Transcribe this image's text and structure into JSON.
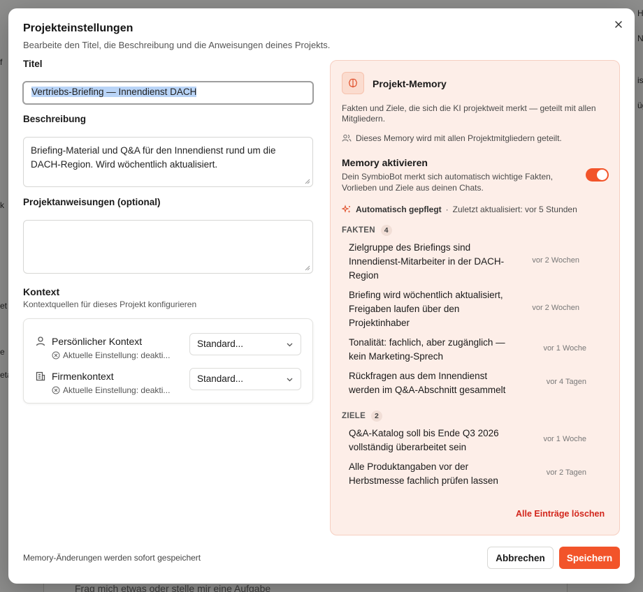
{
  "background": {
    "left_fragments": [
      "f",
      "k",
      "et",
      "e",
      "eta"
    ],
    "right_fragments": [
      "HA",
      "No",
      "is",
      "üg"
    ],
    "composer_placeholder": "Frag mich etwas oder stelle mir eine Aufgabe"
  },
  "dialog": {
    "title": "Projekteinstellungen",
    "subtitle": "Bearbeite den Titel, die Beschreibung und die Anweisungen deines Projekts.",
    "close_icon": "close-icon"
  },
  "form": {
    "title_label": "Titel",
    "title_value": "Vertriebs-Briefing — Innendienst DACH",
    "description_label": "Beschreibung",
    "description_value": "Briefing-Material und Q&A für den Innendienst rund um die DACH-Region. Wird wöchentlich aktualisiert.",
    "instructions_label": "Projektanweisungen (optional)",
    "instructions_value": ""
  },
  "context": {
    "title": "Kontext",
    "subtitle": "Kontextquellen für dieses Projekt konfigurieren",
    "rows": [
      {
        "name": "Persönlicher Kontext",
        "icon": "person-icon",
        "status": "Aktuelle Einstellung: deakti...",
        "select": "Standard..."
      },
      {
        "name": "Firmenkontext",
        "icon": "building-icon",
        "status": "Aktuelle Einstellung: deakti...",
        "select": "Standard..."
      }
    ]
  },
  "memory": {
    "title": "Projekt-Memory",
    "icon": "brain-icon",
    "description": "Fakten und Ziele, die sich die KI projektweit merkt — geteilt mit allen Mitgliedern.",
    "shared_note": "Dieses Memory wird mit allen Projektmitgliedern geteilt.",
    "activate_title": "Memory aktivieren",
    "activate_desc": "Dein SymbioBot merkt sich automatisch wichtige Fakten, Vorlieben und Ziele aus deinen Chats.",
    "enabled": true,
    "auto_label": "Automatisch gepflegt",
    "auto_separator": "·",
    "updated_label": "Zuletzt aktualisiert: vor 5 Stunden",
    "facts_heading": "FAKTEN",
    "facts_count": "4",
    "facts": [
      {
        "text": "Zielgruppe des Briefings sind Innendienst-Mitarbeiter in der DACH-Region",
        "time": "vor 2 Wochen"
      },
      {
        "text": "Briefing wird wöchentlich aktualisiert, Freigaben laufen über den Projektinhaber",
        "time": "vor 2 Wochen"
      },
      {
        "text": "Tonalität: fachlich, aber zugänglich — kein Marketing-Sprech",
        "time": "vor 1 Woche"
      },
      {
        "text": "Rückfragen aus dem Innendienst werden im Q&A-Abschnitt gesammelt",
        "time": "vor 4 Tagen"
      }
    ],
    "goals_heading": "ZIELE",
    "goals_count": "2",
    "goals": [
      {
        "text": "Q&A-Katalog soll bis Ende Q3 2026 vollständig überarbeitet sein",
        "time": "vor 1 Woche"
      },
      {
        "text": "Alle Produktangaben vor der Herbstmesse fachlich prüfen lassen",
        "time": "vor 2 Tagen"
      }
    ],
    "clear_label": "Alle Einträge löschen"
  },
  "footer": {
    "note": "Memory-Änderungen werden sofort gespeichert",
    "cancel_label": "Abbrechen",
    "save_label": "Speichern"
  },
  "colors": {
    "accent": "#f2542a",
    "memory_bg": "#fdeee8",
    "danger": "#d2261c"
  }
}
